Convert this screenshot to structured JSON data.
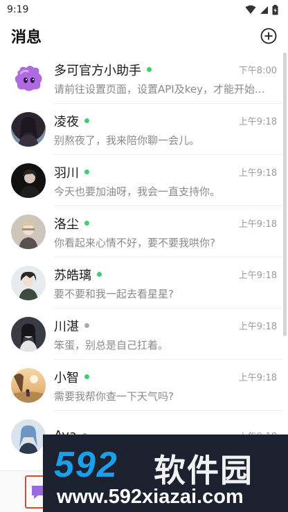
{
  "status_bar": {
    "time": "9:19"
  },
  "header": {
    "title": "消息"
  },
  "chats": [
    {
      "name": "多可官方小助手",
      "online": true,
      "time": "下午8:00",
      "preview": "请前往设置页面，设置API及key，才能开始..."
    },
    {
      "name": "凌夜",
      "online": true,
      "time": "上午9:18",
      "preview": "别熬夜了，我来陪你聊一会儿。"
    },
    {
      "name": "羽川",
      "online": true,
      "time": "上午9:18",
      "preview": "今天也要加油呀，我会一直支持你。"
    },
    {
      "name": "洛尘",
      "online": true,
      "time": "上午9:18",
      "preview": "你看起来心情不好，要不要我哄你?"
    },
    {
      "name": "苏皓璃",
      "online": true,
      "time": "上午9:18",
      "preview": "要不要和我一起去看星星?"
    },
    {
      "name": "川湛",
      "online": false,
      "time": "上午9:18",
      "preview": "笨蛋，别总是自己扛着。"
    },
    {
      "name": "小智",
      "online": true,
      "time": "上午9:18",
      "preview": "需要我帮你查一下天气吗?"
    },
    {
      "name": "Ava",
      "online": false,
      "time": "上午9:18",
      "preview": ""
    }
  ],
  "colors": {
    "online": "#3ccf6e",
    "offline": "#a9a9a9",
    "nav_highlight": "#e0472e",
    "watermark_blue": "#1aa0ea"
  },
  "watermark": {
    "logo": "592",
    "brand": "软件园",
    "url": "www.592xiazai.com"
  }
}
